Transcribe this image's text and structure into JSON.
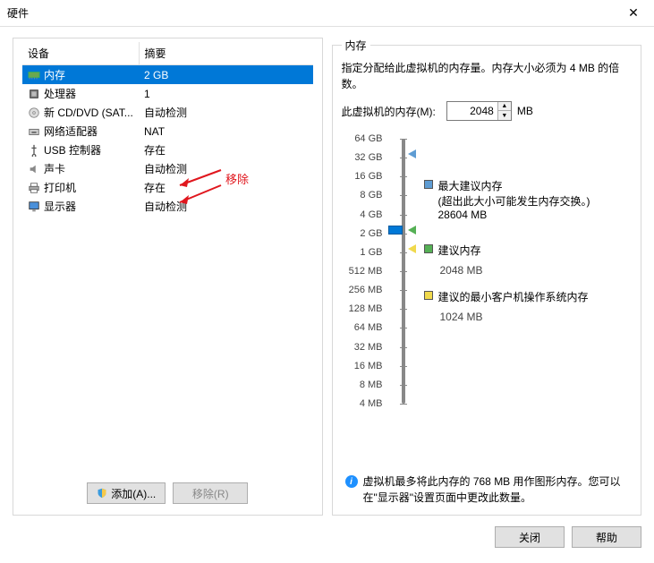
{
  "window": {
    "title": "硬件"
  },
  "table": {
    "col_device": "设备",
    "col_summary": "摘要",
    "rows": [
      {
        "name": "内存",
        "summary": "2 GB",
        "icon": "memory",
        "selected": true
      },
      {
        "name": "处理器",
        "summary": "1",
        "icon": "cpu"
      },
      {
        "name": "新 CD/DVD (SAT...",
        "summary": "自动检测",
        "icon": "cd"
      },
      {
        "name": "网络适配器",
        "summary": "NAT",
        "icon": "net"
      },
      {
        "name": "USB 控制器",
        "summary": "存在",
        "icon": "usb"
      },
      {
        "name": "声卡",
        "summary": "自动检测",
        "icon": "sound"
      },
      {
        "name": "打印机",
        "summary": "存在",
        "icon": "printer"
      },
      {
        "name": "显示器",
        "summary": "自动检测",
        "icon": "display"
      }
    ]
  },
  "annotation": {
    "remove_label": "移除"
  },
  "left_buttons": {
    "add": "添加(A)...",
    "remove": "移除(R)"
  },
  "right": {
    "group_title": "内存",
    "desc": "指定分配给此虚拟机的内存量。内存大小必须为 4 MB 的倍数。",
    "mem_label": "此虚拟机的内存(M):",
    "mem_value": "2048",
    "mem_unit": "MB",
    "ticks": [
      "64 GB",
      "32 GB",
      "16 GB",
      "8 GB",
      "4 GB",
      "2 GB",
      "1 GB",
      "512 MB",
      "256 MB",
      "128 MB",
      "64 MB",
      "32 MB",
      "16 MB",
      "8 MB",
      "4 MB"
    ],
    "legends": {
      "max": {
        "title": "最大建议内存",
        "note": "(超出此大小可能发生内存交换。)",
        "value": "28604 MB",
        "color": "#5e9cd3"
      },
      "rec": {
        "title": "建议内存",
        "value": "2048 MB",
        "color": "#55b055"
      },
      "min": {
        "title": "建议的最小客户机操作系统内存",
        "value": "1024 MB",
        "color": "#f0d94c"
      }
    },
    "info": "虚拟机最多将此内存的 768 MB 用作图形内存。您可以在\"显示器\"设置页面中更改此数量。"
  },
  "dialog": {
    "close": "关闭",
    "help": "帮助"
  },
  "chart_data": {
    "type": "bar",
    "note": "vertical log-scale memory slider",
    "categories": [
      "4 MB",
      "8 MB",
      "16 MB",
      "32 MB",
      "64 MB",
      "128 MB",
      "256 MB",
      "512 MB",
      "1 GB",
      "2 GB",
      "4 GB",
      "8 GB",
      "16 GB",
      "32 GB",
      "64 GB"
    ],
    "current_value_mb": 2048,
    "markers": [
      {
        "name": "max_recommended",
        "value_mb": 28604,
        "color": "#5e9cd3"
      },
      {
        "name": "recommended",
        "value_mb": 2048,
        "color": "#55b055"
      },
      {
        "name": "min_guest_os",
        "value_mb": 1024,
        "color": "#f0d94c"
      }
    ],
    "title": "内存",
    "ylim": [
      "4 MB",
      "64 GB"
    ]
  }
}
